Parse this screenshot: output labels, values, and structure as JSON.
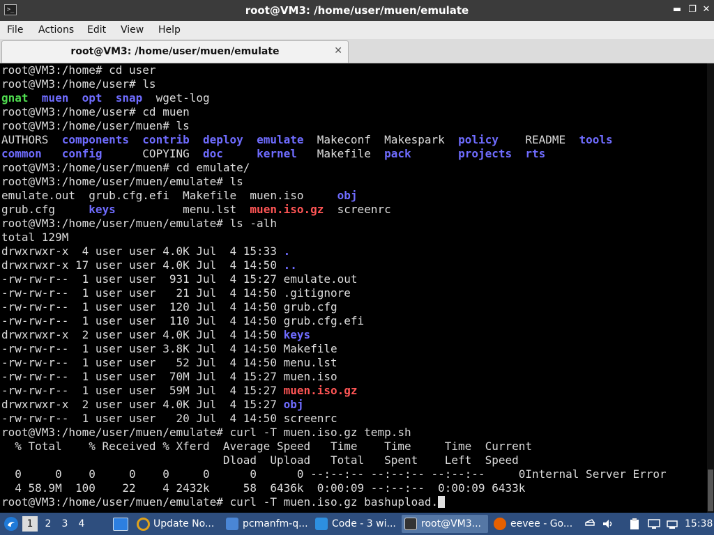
{
  "window": {
    "title": "root@VM3: /home/user/muen/emulate"
  },
  "menu": [
    "File",
    "Actions",
    "Edit",
    "View",
    "Help"
  ],
  "tab": {
    "label": "root@VM3: /home/user/muen/emulate"
  },
  "terminal": {
    "lines": [
      [
        {
          "t": "root@VM3:/home# cd user"
        }
      ],
      [
        {
          "t": "root@VM3:/home/user# ls"
        }
      ],
      [
        {
          "t": "gnat",
          "c": "exe"
        },
        {
          "t": "  "
        },
        {
          "t": "muen",
          "c": "dir"
        },
        {
          "t": "  "
        },
        {
          "t": "opt",
          "c": "dir"
        },
        {
          "t": "  "
        },
        {
          "t": "snap",
          "c": "dir"
        },
        {
          "t": "  wget-log"
        }
      ],
      [
        {
          "t": "root@VM3:/home/user# cd muen"
        }
      ],
      [
        {
          "t": "root@VM3:/home/user/muen# ls"
        }
      ],
      [
        {
          "t": "AUTHORS  "
        },
        {
          "t": "components",
          "c": "dir"
        },
        {
          "t": "  "
        },
        {
          "t": "contrib",
          "c": "dir"
        },
        {
          "t": "  "
        },
        {
          "t": "deploy",
          "c": "dir"
        },
        {
          "t": "  "
        },
        {
          "t": "emulate",
          "c": "dir"
        },
        {
          "t": "  Makeconf  Makespark  "
        },
        {
          "t": "policy",
          "c": "dir"
        },
        {
          "t": "    README  "
        },
        {
          "t": "tools",
          "c": "dir"
        }
      ],
      [
        {
          "t": "common",
          "c": "dir"
        },
        {
          "t": "   "
        },
        {
          "t": "config",
          "c": "dir"
        },
        {
          "t": "      COPYING  "
        },
        {
          "t": "doc",
          "c": "dir"
        },
        {
          "t": "     "
        },
        {
          "t": "kernel",
          "c": "dir"
        },
        {
          "t": "   Makefile  "
        },
        {
          "t": "pack",
          "c": "dir"
        },
        {
          "t": "       "
        },
        {
          "t": "projects",
          "c": "dir"
        },
        {
          "t": "  "
        },
        {
          "t": "rts",
          "c": "dir"
        }
      ],
      [
        {
          "t": "root@VM3:/home/user/muen# cd emulate/"
        }
      ],
      [
        {
          "t": "root@VM3:/home/user/muen/emulate# ls"
        }
      ],
      [
        {
          "t": "emulate.out  grub.cfg.efi  Makefile  muen.iso     "
        },
        {
          "t": "obj",
          "c": "dir"
        }
      ],
      [
        {
          "t": "grub.cfg     "
        },
        {
          "t": "keys",
          "c": "dir"
        },
        {
          "t": "          menu.lst  "
        },
        {
          "t": "muen.iso.gz",
          "c": "arc"
        },
        {
          "t": "  screenrc"
        }
      ],
      [
        {
          "t": "root@VM3:/home/user/muen/emulate# ls -alh"
        }
      ],
      [
        {
          "t": "total 129M"
        }
      ],
      [
        {
          "t": "drwxrwxr-x  4 user user 4.0K Jul  4 15:33 "
        },
        {
          "t": ".",
          "c": "dir"
        }
      ],
      [
        {
          "t": "drwxrwxr-x 17 user user 4.0K Jul  4 14:50 "
        },
        {
          "t": "..",
          "c": "dir"
        }
      ],
      [
        {
          "t": "-rw-rw-r--  1 user user  931 Jul  4 15:27 emulate.out"
        }
      ],
      [
        {
          "t": "-rw-rw-r--  1 user user   21 Jul  4 14:50 .gitignore"
        }
      ],
      [
        {
          "t": "-rw-rw-r--  1 user user  120 Jul  4 14:50 grub.cfg"
        }
      ],
      [
        {
          "t": "-rw-rw-r--  1 user user  110 Jul  4 14:50 grub.cfg.efi"
        }
      ],
      [
        {
          "t": "drwxrwxr-x  2 user user 4.0K Jul  4 14:50 "
        },
        {
          "t": "keys",
          "c": "dir"
        }
      ],
      [
        {
          "t": "-rw-rw-r--  1 user user 3.8K Jul  4 14:50 Makefile"
        }
      ],
      [
        {
          "t": "-rw-rw-r--  1 user user   52 Jul  4 14:50 menu.lst"
        }
      ],
      [
        {
          "t": "-rw-rw-r--  1 user user  70M Jul  4 15:27 muen.iso"
        }
      ],
      [
        {
          "t": "-rw-rw-r--  1 user user  59M Jul  4 15:27 "
        },
        {
          "t": "muen.iso.gz",
          "c": "arc"
        }
      ],
      [
        {
          "t": "drwxrwxr-x  2 user user 4.0K Jul  4 15:27 "
        },
        {
          "t": "obj",
          "c": "dir"
        }
      ],
      [
        {
          "t": "-rw-rw-r--  1 user user   20 Jul  4 14:50 screenrc"
        }
      ],
      [
        {
          "t": "root@VM3:/home/user/muen/emulate# curl -T muen.iso.gz temp.sh"
        }
      ],
      [
        {
          "t": "  % Total    % Received % Xferd  Average Speed   Time    Time     Time  Current"
        }
      ],
      [
        {
          "t": "                                 Dload  Upload   Total   Spent    Left  Speed"
        }
      ],
      [
        {
          "t": "  0     0    0     0    0     0      0      0 --:--:-- --:--:-- --:--:--     0Internal Server Error"
        }
      ],
      [
        {
          "t": "  4 58.9M  100    22    4 2432k     58  6436k  0:00:09 --:--:--  0:00:09 6433k"
        }
      ],
      [
        {
          "t": "root@VM3:/home/user/muen/emulate# curl -T muen.iso.gz bashupload."
        },
        {
          "cursor": true
        }
      ]
    ]
  },
  "taskbar": {
    "workspaces": [
      "1",
      "2",
      "3",
      "4"
    ],
    "tasks": [
      {
        "label": "Update No...",
        "icon": "update-notifier-icon",
        "color": "#e0a21a"
      },
      {
        "label": "pcmanfm-q...",
        "icon": "folder-icon",
        "color": "#4a86d6"
      },
      {
        "label": "Code - 3 wi...",
        "icon": "vscode-icon",
        "color": "#2d8fe0"
      },
      {
        "label": "root@VM3...",
        "icon": "terminal-icon",
        "color": "#333333"
      },
      {
        "label": "eevee - Go...",
        "icon": "firefox-icon",
        "color": "#e66000"
      }
    ],
    "clock": "15:38"
  }
}
